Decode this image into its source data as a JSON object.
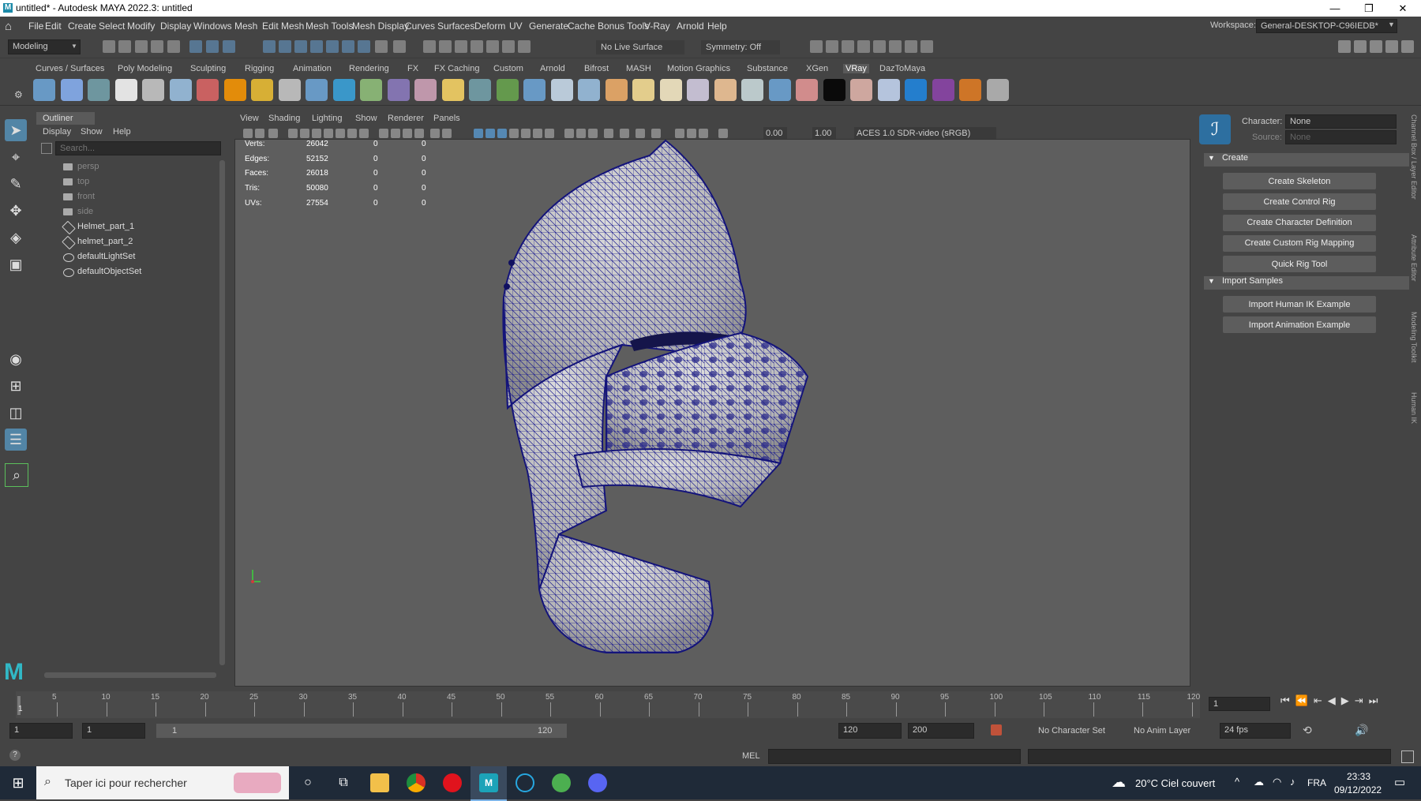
{
  "window": {
    "title": "untitled* - Autodesk MAYA 2022.3: untitled",
    "minimize": "—",
    "restore": "❐",
    "close": "✕"
  },
  "menus": [
    "File",
    "Edit",
    "Create",
    "Select",
    "Modify",
    "Display",
    "Windows",
    "Mesh",
    "Edit Mesh",
    "Mesh Tools",
    "Mesh Display",
    "Curves",
    "Surfaces",
    "Deform",
    "UV",
    "Generate",
    "Cache",
    "Bonus Tools",
    "V-Ray",
    "Arnold",
    "Help"
  ],
  "workspace": {
    "label": "Workspace:",
    "value": "General-DESKTOP-C96IEDB*"
  },
  "statusline": {
    "mode": "Modeling",
    "live_surface": "No Live Surface",
    "symmetry": "Symmetry: Off"
  },
  "shelf_tabs": [
    "Curves / Surfaces",
    "Poly Modeling",
    "Sculpting",
    "Rigging",
    "Animation",
    "Rendering",
    "FX",
    "FX Caching",
    "Custom",
    "Arnold",
    "Bifrost",
    "MASH",
    "Motion Graphics",
    "Substance",
    "XGen",
    "VRay",
    "DazToMaya"
  ],
  "outliner": {
    "title": "Outliner",
    "menu": [
      "Display",
      "Show",
      "Help"
    ],
    "search_placeholder": "Search...",
    "items": [
      {
        "label": "persp",
        "dim": true,
        "icon": "camera-icon"
      },
      {
        "label": "top",
        "dim": true,
        "icon": "camera-icon"
      },
      {
        "label": "front",
        "dim": true,
        "icon": "camera-icon"
      },
      {
        "label": "side",
        "dim": true,
        "icon": "camera-icon"
      },
      {
        "label": "Helmet_part_1",
        "dim": false,
        "icon": "mesh-icon"
      },
      {
        "label": "helmet_part_2",
        "dim": false,
        "icon": "mesh-icon"
      },
      {
        "label": "defaultLightSet",
        "dim": false,
        "icon": "set-icon"
      },
      {
        "label": "defaultObjectSet",
        "dim": false,
        "icon": "set-icon"
      }
    ]
  },
  "viewport": {
    "menu": [
      "View",
      "Shading",
      "Lighting",
      "Show",
      "Renderer",
      "Panels"
    ],
    "exposure": "0.00",
    "gamma": "1.00",
    "colorspace": "ACES 1.0 SDR-video (sRGB)",
    "hud": [
      {
        "label": "Verts:",
        "v1": "26042",
        "v2": "0",
        "v3": "0"
      },
      {
        "label": "Edges:",
        "v1": "52152",
        "v2": "0",
        "v3": "0"
      },
      {
        "label": "Faces:",
        "v1": "26018",
        "v2": "0",
        "v3": "0"
      },
      {
        "label": "Tris:",
        "v1": "50080",
        "v2": "0",
        "v3": "0"
      },
      {
        "label": "UVs:",
        "v1": "27554",
        "v2": "0",
        "v3": "0"
      }
    ]
  },
  "hik": {
    "character_label": "Character:",
    "character_value": "None",
    "source_label": "Source:",
    "source_value": "None",
    "create_section": "Create",
    "create_buttons": [
      "Create Skeleton",
      "Create Control Rig",
      "Create Character Definition",
      "Create Custom Rig Mapping",
      "Quick Rig Tool"
    ],
    "import_section": "Import Samples",
    "import_buttons": [
      "Import Human IK Example",
      "Import Animation Example"
    ],
    "side_tabs": [
      "Channel Box / Layer Editor",
      "Attribute Editor",
      "Modeling Toolkit",
      "Human IK"
    ]
  },
  "timeline": {
    "ticks": [
      "5",
      "10",
      "15",
      "20",
      "25",
      "30",
      "35",
      "40",
      "45",
      "50",
      "55",
      "60",
      "65",
      "70",
      "75",
      "80",
      "85",
      "90",
      "95",
      "100",
      "105",
      "110",
      "115",
      "120"
    ],
    "start_label": "1",
    "current_frame": "1"
  },
  "range": {
    "start": "1",
    "start2": "1",
    "slider_start": "1",
    "slider_end": "120",
    "end": "120",
    "end2": "200",
    "character_set": "No Character Set",
    "anim_layer": "No Anim Layer",
    "fps": "24 fps"
  },
  "cmdline": {
    "lang": "MEL"
  },
  "taskbar": {
    "search_placeholder": "Taper ici pour rechercher",
    "weather": "20°C  Ciel couvert",
    "lang": "FRA",
    "time": "23:33",
    "date": "09/12/2022"
  },
  "colors": {
    "accent": "#5285a6",
    "wire": "#1a1a8c",
    "viewport_bg": "#5e5e5e"
  }
}
